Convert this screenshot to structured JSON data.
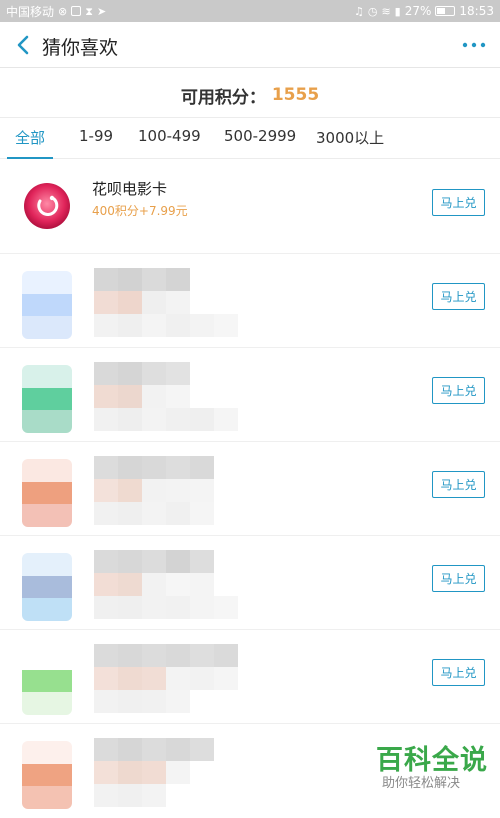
{
  "status_bar": {
    "carrier": "中国移动",
    "battery": "27%",
    "time": "18:53",
    "icons": [
      "sim-icon",
      "app-icon",
      "hourglass-icon",
      "send-icon",
      "headset-icon",
      "alarm-icon",
      "wifi-icon",
      "signal-icon",
      "battery-icon"
    ]
  },
  "header": {
    "title": "猜你喜欢",
    "accent_color": "#2196c4"
  },
  "points": {
    "label": "可用积分：",
    "value": "1555",
    "value_color": "#e8a04b"
  },
  "tabs": [
    {
      "label": "全部",
      "active": true
    },
    {
      "label": "1-99",
      "active": false
    },
    {
      "label": "100-499",
      "active": false
    },
    {
      "label": "500-2999",
      "active": false
    },
    {
      "label": "3000以上",
      "active": false
    }
  ],
  "items": [
    {
      "title": "花呗电影卡",
      "subtitle": "400积分+7.99元",
      "button": "马上兑",
      "icon": "film-card-icon"
    },
    {
      "title": "",
      "subtitle": "",
      "button": "马上兑",
      "icon": "blurred-icon"
    },
    {
      "title": "",
      "subtitle": "",
      "button": "马上兑",
      "icon": "blurred-icon"
    },
    {
      "title": "",
      "subtitle": "",
      "button": "马上兑",
      "icon": "blurred-icon"
    },
    {
      "title": "",
      "subtitle": "",
      "button": "马上兑",
      "icon": "blurred-icon"
    },
    {
      "title": "",
      "subtitle": "",
      "button": "马上兑",
      "icon": "blurred-icon"
    },
    {
      "title": "",
      "subtitle": "",
      "button": "",
      "icon": "blurred-icon"
    }
  ],
  "watermark": {
    "title": "百科全说",
    "subtitle": "助你轻松解决"
  }
}
